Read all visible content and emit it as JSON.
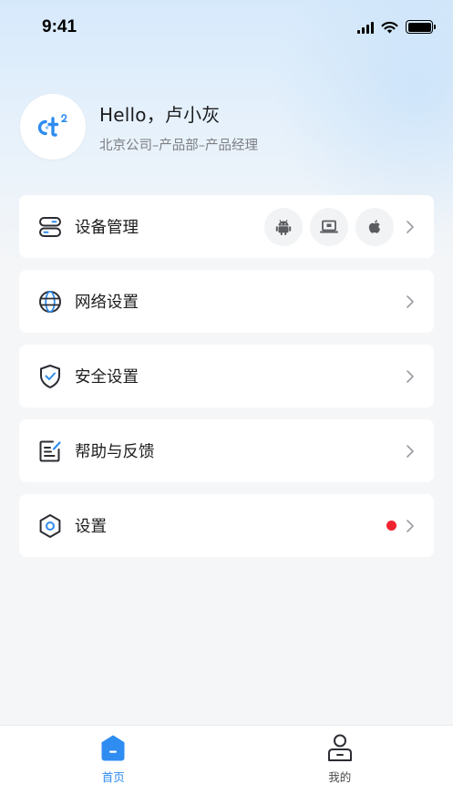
{
  "status_bar": {
    "time": "9:41"
  },
  "profile": {
    "greeting": "Hello，卢小灰",
    "subtitle": "北京公司–产品部–产品经理",
    "avatar_icon": "company-logo-icon"
  },
  "menu": {
    "items": [
      {
        "label": "设备管理",
        "icon": "device-manage-icon",
        "platforms": [
          "android-icon",
          "desktop-icon",
          "apple-icon"
        ]
      },
      {
        "label": "网络设置",
        "icon": "globe-icon"
      },
      {
        "label": "安全设置",
        "icon": "shield-check-icon"
      },
      {
        "label": "帮助与反馈",
        "icon": "feedback-edit-icon"
      },
      {
        "label": "设置",
        "icon": "hexagon-settings-icon",
        "badge": "red-dot"
      }
    ]
  },
  "tab_bar": {
    "tabs": [
      {
        "label": "首页",
        "icon": "home-icon",
        "active": true
      },
      {
        "label": "我的",
        "icon": "user-icon",
        "active": false
      }
    ]
  },
  "colors": {
    "accent": "#2f8cf0",
    "badge": "#f2232f",
    "text_primary": "#1c1c1e",
    "text_secondary": "#7d7f84",
    "icon_stroke": "#2b2d33",
    "background": "#f5f6f7"
  }
}
